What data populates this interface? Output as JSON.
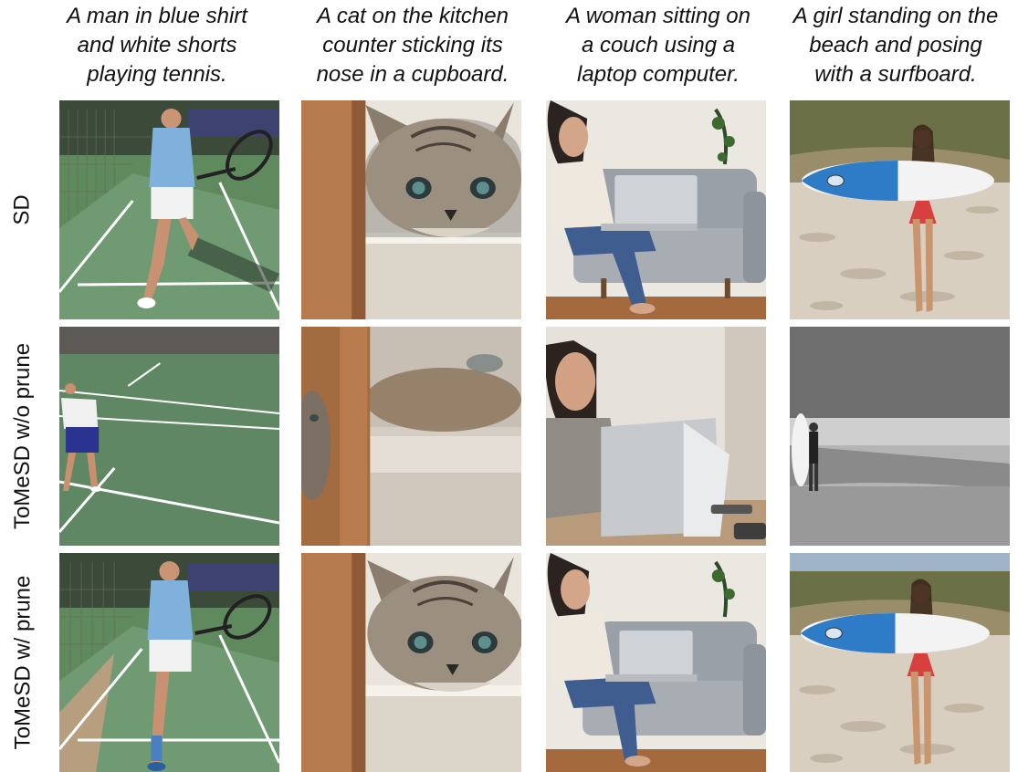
{
  "captions": [
    [
      "A man in blue shirt",
      "and white shorts",
      "playing tennis."
    ],
    [
      "A cat on the kitchen",
      "counter sticking its",
      "nose in a cupboard."
    ],
    [
      "A woman sitting on",
      "a couch using a",
      "laptop computer."
    ],
    [
      "A girl standing on the",
      "beach and posing",
      "with a surfboard."
    ]
  ],
  "row_labels": [
    "SD",
    "ToMeSD w/o prune",
    "ToMeSD w/ prune"
  ],
  "images": [
    [
      "tennis-player-photo",
      "cat-cupboard-photo",
      "woman-laptop-couch-photo",
      "girl-surfboard-beach-photo"
    ],
    [
      "tennis-player-far-photo",
      "cat-blurry-photo",
      "woman-laptop-desk-photo",
      "surfer-shore-grayscale-photo"
    ],
    [
      "tennis-player-photo",
      "cat-cupboard-photo",
      "woman-laptop-couch-photo",
      "girl-surfboard-beach-photo"
    ]
  ]
}
